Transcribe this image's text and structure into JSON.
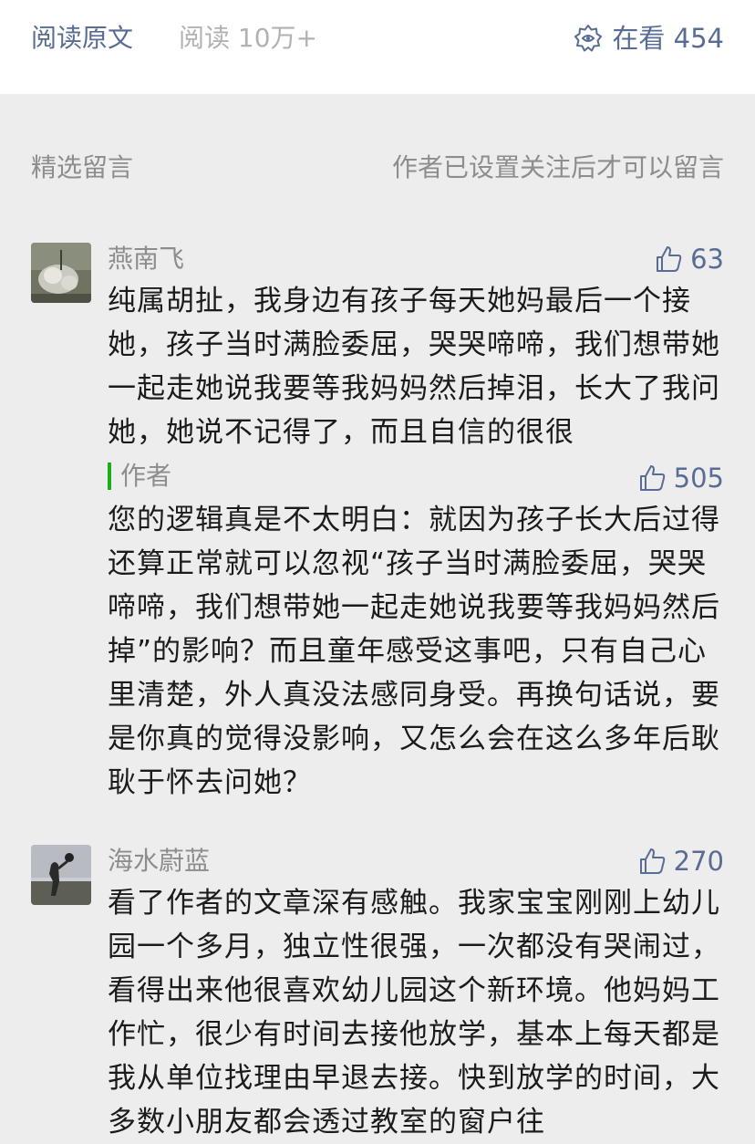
{
  "topbar": {
    "read_original": "阅读原文",
    "read_count": "阅读 10万+",
    "watching_icon": "watching-icon",
    "watching_label": "在看 454"
  },
  "comments_section": {
    "title": "精选留言",
    "notice": "作者已设置关注后才可以留言"
  },
  "comments": [
    {
      "nickname": "燕南飞",
      "likes": "63",
      "content": "纯属胡扯，我身边有孩子每天她妈最后一个接她，孩子当时满脸委屈，哭哭啼啼，我们想带她一起走她说我要等我妈妈然后掉泪，长大了我问她，她说不记得了，而且自信的很很",
      "reply": {
        "label": "作者",
        "likes": "505",
        "content": "您的逻辑真是不太明白：就因为孩子长大后过得还算正常就可以忽视“孩子当时满脸委屈，哭哭啼啼，我们想带她一起走她说我要等我妈妈然后掉”的影响？而且童年感受这事吧，只有自己心里清楚，外人真没法感同身受。再换句话说，要是你真的觉得没影响，又怎么会在这么多年后耿耿于怀去问她？"
      }
    },
    {
      "nickname": "海水蔚蓝",
      "likes": "270",
      "content": "看了作者的文章深有感触。我家宝宝刚刚上幼儿园一个多月，独立性很强，一次都没有哭闹过，看得出来他很喜欢幼儿园这个新环境。他妈妈工作忙，很少有时间去接他放学，基本上每天都是我从单位找理由早退去接。快到放学的时间，大多数小朋友都会透过教室的窗户往"
    }
  ],
  "colors": {
    "link_blue": "#586c94",
    "muted_gray": "#8d8d8d",
    "author_green": "#1aad19",
    "background": "#ededed"
  }
}
